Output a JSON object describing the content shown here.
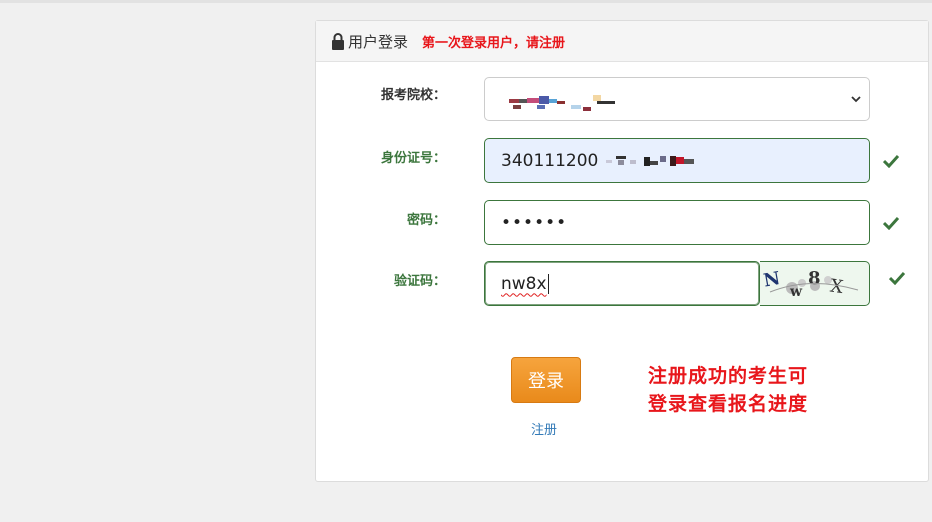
{
  "header": {
    "title": "用户登录",
    "note": "第一次登录用户，请注册"
  },
  "form": {
    "school_label": "报考院校：",
    "id_label": "身份证号：",
    "id_value": "340111200",
    "password_label": "密码：",
    "password_value": "••••••",
    "captcha_label": "验证码：",
    "captcha_value": "nw8x",
    "captcha_image_text": "N w 8 X"
  },
  "actions": {
    "login_label": "登录",
    "register_label": "注册"
  },
  "promo": {
    "line1": "注册成功的考生可",
    "line2": "登录查看报名进度"
  },
  "colors": {
    "accent_orange": "#f0962b",
    "valid_green": "#3c763d",
    "warning_red": "#e8161b",
    "link_blue": "#337ab7"
  }
}
